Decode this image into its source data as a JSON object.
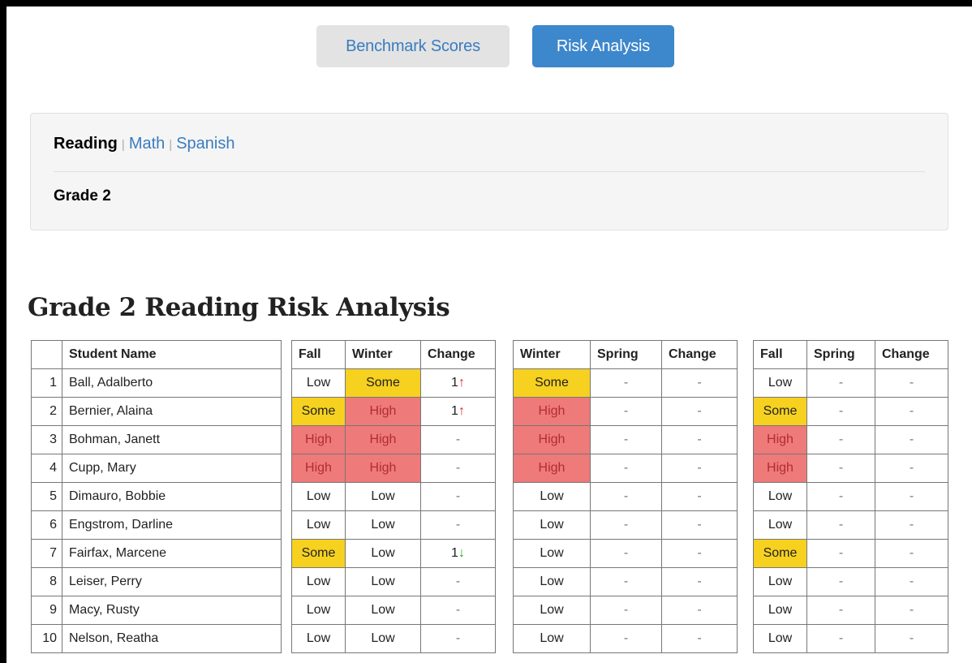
{
  "tabs": [
    {
      "label": "Benchmark Scores",
      "active": false
    },
    {
      "label": "Risk Analysis",
      "active": true
    }
  ],
  "filter": {
    "subjects": [
      {
        "label": "Reading",
        "selected": true
      },
      {
        "label": "Math",
        "selected": false
      },
      {
        "label": "Spanish",
        "selected": false
      }
    ],
    "separator": "|",
    "grade": "Grade 2"
  },
  "title": "Grade 2 Reading Risk Analysis",
  "tables": {
    "students": {
      "header": "Student Name"
    },
    "fall_winter": {
      "headers": [
        "Fall",
        "Winter",
        "Change"
      ]
    },
    "winter_spring": {
      "headers": [
        "Winter",
        "Spring",
        "Change"
      ]
    },
    "fall_spring": {
      "headers": [
        "Fall",
        "Spring",
        "Change"
      ]
    }
  },
  "students": [
    {
      "num": "1",
      "name": "Ball, Adalberto",
      "fw": [
        "Low",
        "Some",
        "1"
      ],
      "fw_dir": "up",
      "ws": [
        "Some",
        "-",
        "-"
      ],
      "fs": [
        "Low",
        "-",
        "-"
      ]
    },
    {
      "num": "2",
      "name": "Bernier, Alaina",
      "fw": [
        "Some",
        "High",
        "1"
      ],
      "fw_dir": "up",
      "ws": [
        "High",
        "-",
        "-"
      ],
      "fs": [
        "Some",
        "-",
        "-"
      ]
    },
    {
      "num": "3",
      "name": "Bohman, Janett",
      "fw": [
        "High",
        "High",
        "-"
      ],
      "fw_dir": "",
      "ws": [
        "High",
        "-",
        "-"
      ],
      "fs": [
        "High",
        "-",
        "-"
      ]
    },
    {
      "num": "4",
      "name": "Cupp, Mary",
      "fw": [
        "High",
        "High",
        "-"
      ],
      "fw_dir": "",
      "ws": [
        "High",
        "-",
        "-"
      ],
      "fs": [
        "High",
        "-",
        "-"
      ]
    },
    {
      "num": "5",
      "name": "Dimauro, Bobbie",
      "fw": [
        "Low",
        "Low",
        "-"
      ],
      "fw_dir": "",
      "ws": [
        "Low",
        "-",
        "-"
      ],
      "fs": [
        "Low",
        "-",
        "-"
      ]
    },
    {
      "num": "6",
      "name": "Engstrom, Darline",
      "fw": [
        "Low",
        "Low",
        "-"
      ],
      "fw_dir": "",
      "ws": [
        "Low",
        "-",
        "-"
      ],
      "fs": [
        "Low",
        "-",
        "-"
      ]
    },
    {
      "num": "7",
      "name": "Fairfax, Marcene",
      "fw": [
        "Some",
        "Low",
        "1"
      ],
      "fw_dir": "down",
      "ws": [
        "Low",
        "-",
        "-"
      ],
      "fs": [
        "Some",
        "-",
        "-"
      ]
    },
    {
      "num": "8",
      "name": "Leiser, Perry",
      "fw": [
        "Low",
        "Low",
        "-"
      ],
      "fw_dir": "",
      "ws": [
        "Low",
        "-",
        "-"
      ],
      "fs": [
        "Low",
        "-",
        "-"
      ]
    },
    {
      "num": "9",
      "name": "Macy, Rusty",
      "fw": [
        "Low",
        "Low",
        "-"
      ],
      "fw_dir": "",
      "ws": [
        "Low",
        "-",
        "-"
      ],
      "fs": [
        "Low",
        "-",
        "-"
      ]
    },
    {
      "num": "10",
      "name": "Nelson, Reatha",
      "fw": [
        "Low",
        "Low",
        "-"
      ],
      "fw_dir": "",
      "ws": [
        "Low",
        "-",
        "-"
      ],
      "fs": [
        "Low",
        "-",
        "-"
      ]
    }
  ],
  "arrows": {
    "up": "↑",
    "down": "↓"
  },
  "colors": {
    "some": "#f6d11f",
    "high": "#ee7a7a",
    "link": "#3a7cc0",
    "active_tab": "#3d87cc"
  }
}
